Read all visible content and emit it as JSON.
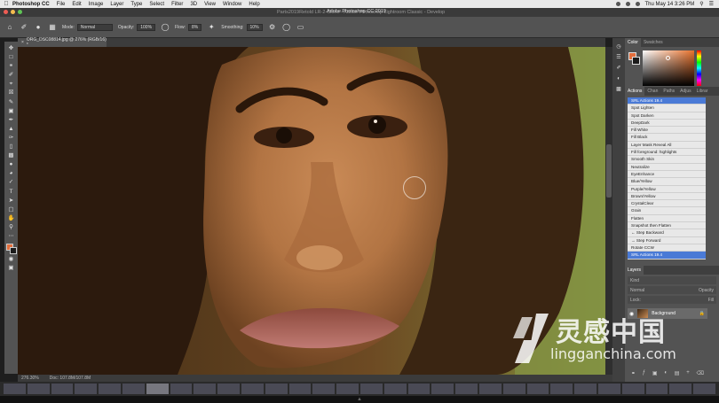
{
  "menubar": {
    "app_name": "Photoshop CC",
    "items": [
      "File",
      "Edit",
      "Image",
      "Layer",
      "Type",
      "Select",
      "Filter",
      "3D",
      "View",
      "Window",
      "Help"
    ],
    "clock": "Thu May 14 3:26 PM"
  },
  "window": {
    "doc_path": "Parts2019Retold LR-2-Clone - Adobe Photoshop Lightroom Classic - Develop",
    "title": "Adobe Photoshop CC 2019"
  },
  "options": {
    "mode_label": "Mode:",
    "mode_value": "Normal",
    "opacity_label": "Opacity:",
    "opacity_value": "100%",
    "flow_label": "Flow:",
    "flow_value": "8%",
    "smoothing_label": "Smoothing:",
    "smoothing_value": "10%"
  },
  "document": {
    "tab_label": "ORG_DSC08814.jpg @ 276% (RGB/16) *",
    "zoom": "276.30%",
    "doc_info": "Doc: 107.8M/107.8M"
  },
  "color_panel": {
    "tabs": [
      "Color",
      "Swatches"
    ],
    "foreground": "#e36e3c",
    "background": "#1b1b1b"
  },
  "actions_panel": {
    "tabs": [
      "Actions",
      "Chan",
      "Paths",
      "Adjus",
      "Librar"
    ],
    "set_name": "SRL Actions 19.4",
    "items": [
      "Spot Lighten",
      "Spot Darken",
      "DeepDark",
      "Fill White",
      "Fill Black",
      "Layer Mask Reveal All",
      "Fill foreground: highlights",
      "Smooth Skin",
      "Neutralize",
      "EyeEnhance",
      "Blue/Yellow",
      "Purple/Yellow",
      "Brown/Yellow",
      "CrystalClear",
      "Grain",
      "Flatten",
      "Snapshot then Flatten",
      "← Step Backward",
      "→ Step Forward",
      "Rotate CCW",
      "SRL Actions 19.4"
    ],
    "selected_index": 20
  },
  "layers_panel": {
    "title": "Layers",
    "kind_filter": "Kind",
    "blend": "Normal",
    "opacity": "Opacity",
    "lock": "Lock:",
    "fill": "Fill",
    "background_layer": "Background"
  },
  "watermark": {
    "chinese": "灵感中国",
    "site": "lingganchina.com"
  }
}
